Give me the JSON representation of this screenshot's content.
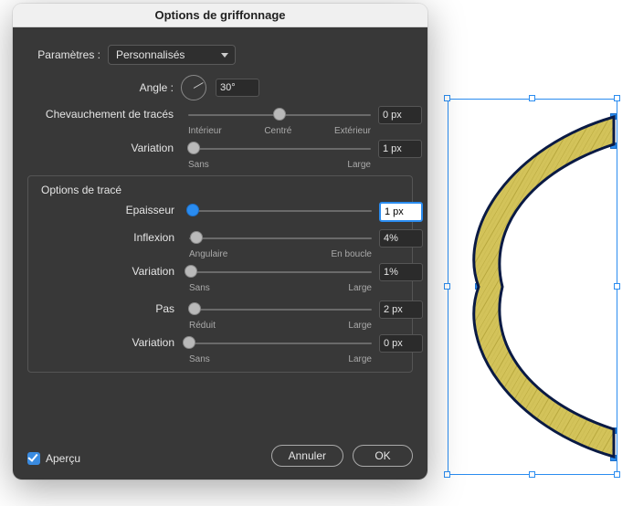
{
  "dialog": {
    "title": "Options de griffonnage",
    "params_label": "Paramètres",
    "params_value": "Personnalisés",
    "angle_label": "Angle",
    "angle_value": "30°",
    "overlap_label": "Chevauchement de tracés",
    "overlap_value": "0 px",
    "overlap_ticks": {
      "left": "Intérieur",
      "mid": "Centré",
      "right": "Extérieur"
    },
    "overlap_var_label": "Variation",
    "overlap_var_value": "1 px",
    "overlap_var_ticks": {
      "left": "Sans",
      "right": "Large"
    },
    "trace_section": "Options de tracé",
    "thickness_label": "Epaisseur",
    "thickness_value": "1 px",
    "inflexion_label": "Inflexion",
    "inflexion_value": "4%",
    "inflexion_ticks": {
      "left": "Angulaire",
      "right": "En boucle"
    },
    "inflexion_var_label": "Variation",
    "inflexion_var_value": "1%",
    "inflexion_var_ticks": {
      "left": "Sans",
      "right": "Large"
    },
    "step_label": "Pas",
    "step_value": "2 px",
    "step_ticks": {
      "left": "Réduit",
      "right": "Large"
    },
    "step_var_label": "Variation",
    "step_var_value": "0 px",
    "step_var_ticks": {
      "left": "Sans",
      "right": "Large"
    },
    "preview_checkbox": "Aperçu",
    "cancel": "Annuler",
    "ok": "OK"
  }
}
